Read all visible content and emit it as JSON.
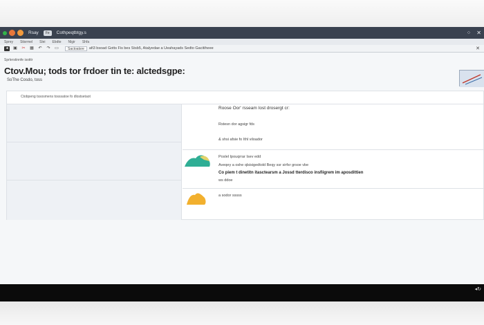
{
  "window": {
    "app_name": "Rsay",
    "tab_chip": "Fe",
    "title": "Cothpeqtbtgy.s"
  },
  "menubar": {
    "items": [
      "Sprey",
      "Stisrmel",
      "Slei",
      "Ebdte",
      "Nlgir",
      "Shfa"
    ]
  },
  "toolbar": {
    "addr_value": "Sactoatsre",
    "addr_text": "afi3 bsoad Gotts Fis bes Stsb5, Atalyedae a Ueahayads Sedto Gacitiheee"
  },
  "breadcrumb": "Sprlerstinnfe isotitr",
  "page_title": "Ctov.Mou; tods tor frdoer tin te: alctedsgpe:",
  "subtitle": "SoThe Cosdo, toss",
  "panel": {
    "header": "Ctobpeng tssosmens tosssatoe fo dlostsetaot",
    "section_title": "Roose Oor' rsseam Iost drosergt cr:",
    "row1": {
      "lines": [
        "Rstesn dor agsigr fds",
        "& shsi afsie fo Ithl viloador"
      ]
    },
    "row2": {
      "lines": [
        "Poslel Ipouqrrar Isev edd",
        "Aveqey a oshe qlsisigedtold Beqy ssr sirfsr grsoe vbe",
        "Co piem t dinetitn itasctearsm a Jossd tterdisco insfiigrem im aposdittien",
        "ws ddoe"
      ],
      "bold_index": [
        2
      ]
    },
    "row3": {
      "lines": [
        "a sodor sssss"
      ]
    }
  },
  "colors": {
    "titlebar": "#3a4250",
    "teal_shape": "#2fae95",
    "yellow_shape": "#f2b02e"
  },
  "icons": [
    "window-green-dot",
    "window-orange-dot",
    "window-amber-dot",
    "minimize-icon",
    "maximize-icon",
    "close-icon",
    "back-icon",
    "image-icon",
    "grid-icon",
    "scissors-icon",
    "undo-icon",
    "redo-icon",
    "folder-icon",
    "settings-icon",
    "teal-blob-icon",
    "yellow-blob-icon"
  ]
}
